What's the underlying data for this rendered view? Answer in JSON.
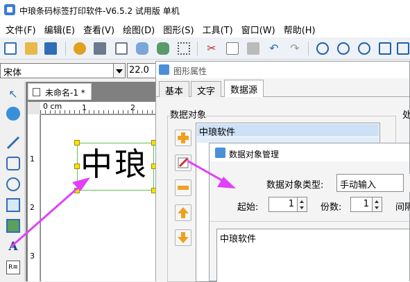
{
  "app": {
    "title": "中琅条码标签打印软件-V6.5.2 试用版 单机",
    "brand_color": "#3a7bd5"
  },
  "menu": [
    {
      "label": "文件(F)"
    },
    {
      "label": "编辑(E)"
    },
    {
      "label": "查看(V)"
    },
    {
      "label": "绘图(D)"
    },
    {
      "label": "图形(S)"
    },
    {
      "label": "工具(T)"
    },
    {
      "label": "窗口(W)"
    },
    {
      "label": "帮助(H)"
    }
  ],
  "toolbar": {
    "icons": [
      "new-icon",
      "open-icon",
      "save-icon",
      "settings-icon",
      "print-icon",
      "print-preview-icon",
      "database-icon",
      "database-settings-icon",
      "grid-icon",
      "cut-icon",
      "copy-icon",
      "paste-icon",
      "undo-icon",
      "redo-icon",
      "zoom-in-icon",
      "zoom-out-icon",
      "zoom-fit-icon",
      "zoom-page-icon",
      "zoom-actual-icon"
    ]
  },
  "fontbar": {
    "font_value": "宋体",
    "size_value": "22.0"
  },
  "document": {
    "tab_label": "未命名-1 *",
    "ruler_unit": "0 cm",
    "ruler_marks": [
      "1",
      "2"
    ],
    "ruler_left_marks": [
      "1",
      "2",
      "3"
    ],
    "label_text": "中琅"
  },
  "graphic_properties": {
    "title": "图形属性",
    "tabs": [
      {
        "label": "基本"
      },
      {
        "label": "文字"
      },
      {
        "label": "数据源"
      }
    ],
    "data_object_label": "数据对象",
    "right_label": "处",
    "list_items": [
      "中琅软件"
    ]
  },
  "data_object_dialog": {
    "title": "数据对象管理",
    "type_label": "数据对象类型:",
    "type_value": "手动输入",
    "start_label": "起始:",
    "start_value": "1",
    "copies_label": "份数:",
    "copies_value": "1",
    "interval_label": "间隔",
    "content": "中琅软件"
  },
  "colors": {
    "annotation_arrow": "#e040fb",
    "selection_handle": "#ffe000",
    "selection_border": "#59c259",
    "list_selection": "#cde0f5"
  }
}
